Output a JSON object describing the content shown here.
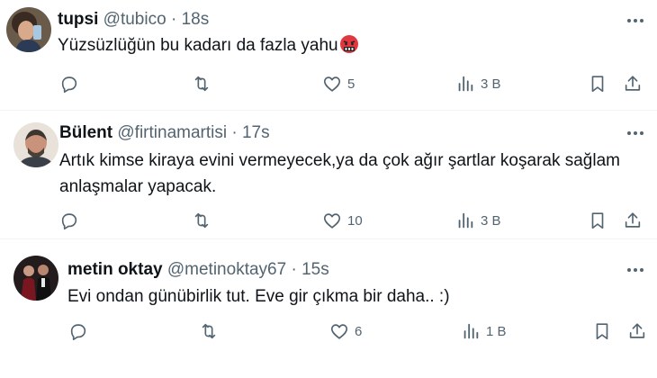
{
  "tweets": [
    {
      "author_name": "tupsi",
      "handle": "@tubico",
      "separator": "·",
      "time": "18s",
      "text": "Yüzsüzlüğün bu kadarı da fazla yahu",
      "emoji": "face-with-symbols-on-mouth",
      "likes": "5",
      "views": "3 B"
    },
    {
      "author_name": "Bülent",
      "handle": "@firtinamartisi",
      "separator": "·",
      "time": "17s",
      "text_line1": "Artık kimse kiraya evini vermeyecek,ya da çok ağır şartlar koşarak sağlam",
      "text_line2": "anlaşmalar yapacak.",
      "likes": "10",
      "views": "3 B"
    },
    {
      "author_name": "metin oktay",
      "handle": "@metinoktay67",
      "separator": "·",
      "time": "15s",
      "text": "Evi ondan günübirlik tut. Eve gir çıkma bir daha.. :)",
      "likes": "6",
      "views": "1 B"
    }
  ],
  "icons": {
    "reply": "reply-icon",
    "retweet": "retweet-icon",
    "like": "heart-icon",
    "views": "views-icon",
    "bookmark": "bookmark-icon",
    "share": "share-icon",
    "more": "more-icon"
  },
  "colors": {
    "text": "#0f1419",
    "secondary": "#536471",
    "divider": "#eff3f4",
    "emoji_red": "#e0383e"
  }
}
